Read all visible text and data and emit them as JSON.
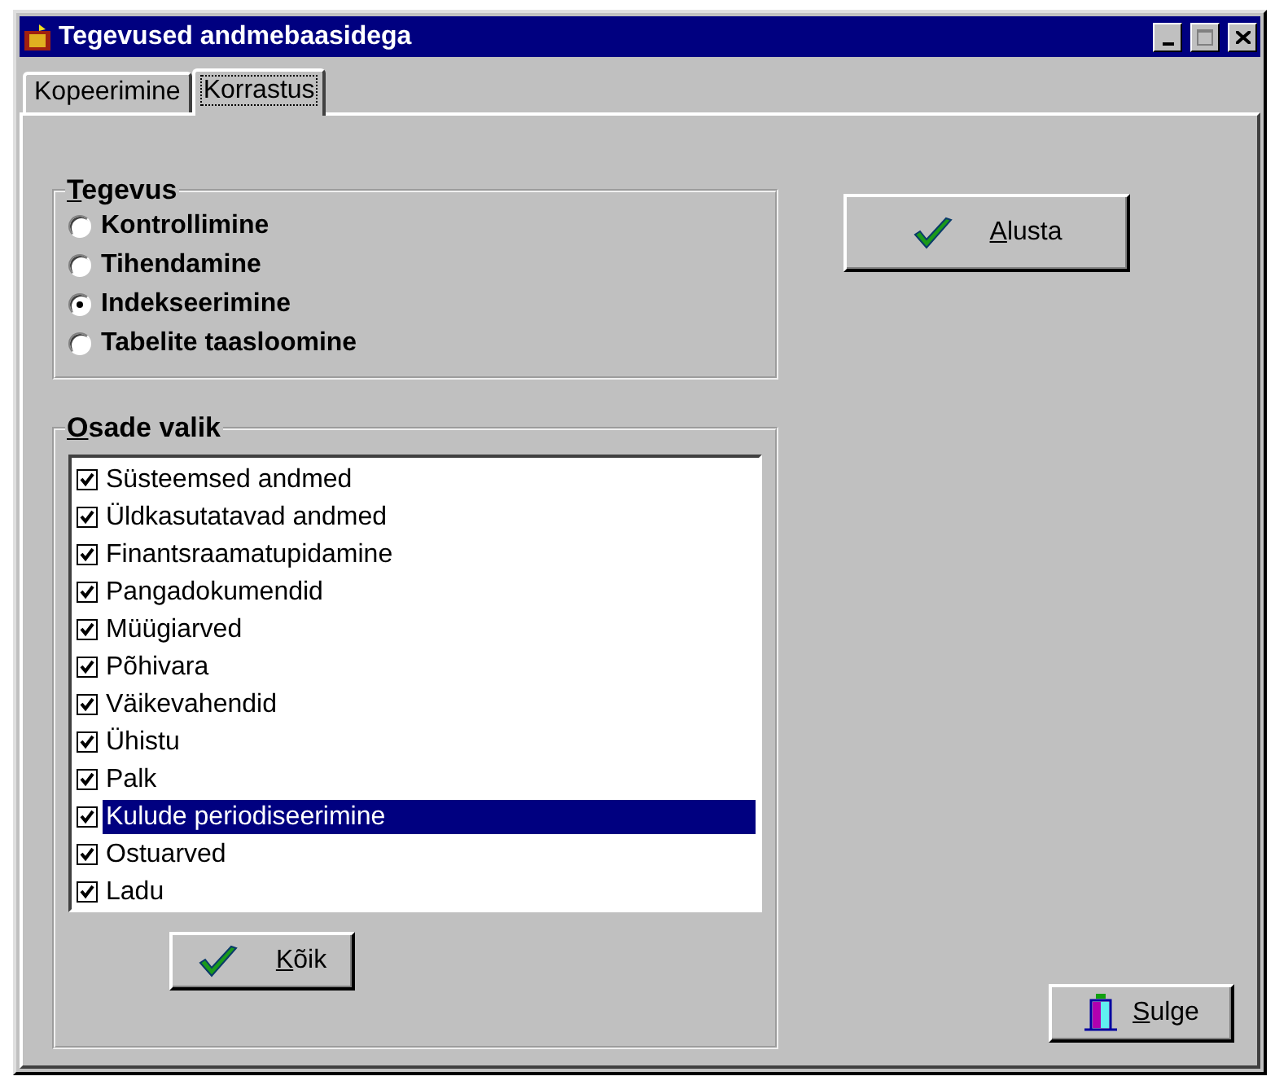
{
  "window": {
    "title": "Tegevused andmebaasidega"
  },
  "tabs": [
    {
      "label": "Kopeerimine",
      "selected": false
    },
    {
      "label": "Korrastus",
      "selected": true
    }
  ],
  "action_group": {
    "title": "Tegevus",
    "options": [
      {
        "label": "Kontrollimine",
        "selected": false
      },
      {
        "label": "Tihendamine",
        "selected": false
      },
      {
        "label": "Indekseerimine",
        "selected": true
      },
      {
        "label": "Tabelite taasloomine",
        "selected": false
      }
    ]
  },
  "start_button": "Alusta",
  "parts_group": {
    "title": "Osade valik",
    "items": [
      {
        "label": "Süsteemsed andmed",
        "checked": true,
        "selected": false
      },
      {
        "label": "Üldkasutatavad andmed",
        "checked": true,
        "selected": false
      },
      {
        "label": "Finantsraamatupidamine",
        "checked": true,
        "selected": false
      },
      {
        "label": "Pangadokumendid",
        "checked": true,
        "selected": false
      },
      {
        "label": "Müügiarved",
        "checked": true,
        "selected": false
      },
      {
        "label": "Põhivara",
        "checked": true,
        "selected": false
      },
      {
        "label": "Väikevahendid",
        "checked": true,
        "selected": false
      },
      {
        "label": "Ühistu",
        "checked": true,
        "selected": false
      },
      {
        "label": "Palk",
        "checked": true,
        "selected": false
      },
      {
        "label": "Kulude periodiseerimine",
        "checked": true,
        "selected": true
      },
      {
        "label": "Ostuarved",
        "checked": true,
        "selected": false
      },
      {
        "label": "Ladu",
        "checked": true,
        "selected": false
      }
    ],
    "all_button": "Kõik"
  },
  "close_button": "Sulge"
}
